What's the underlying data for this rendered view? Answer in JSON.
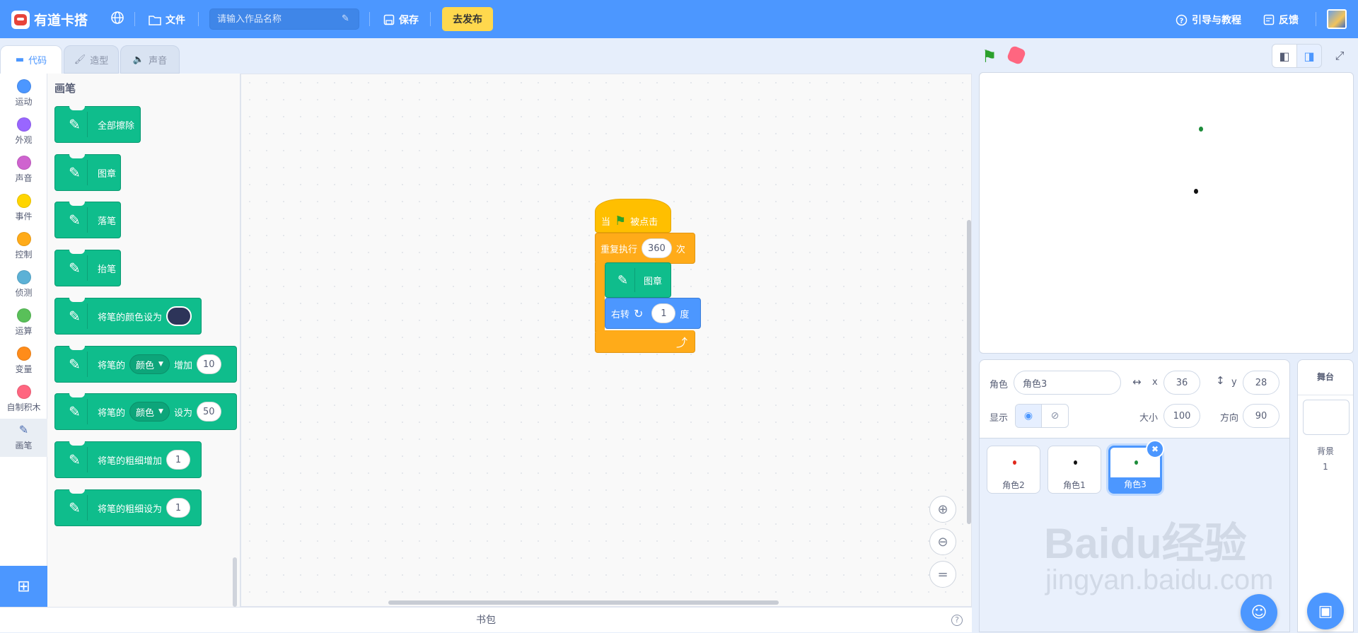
{
  "app": {
    "name": "有道卡搭",
    "file_label": "文件",
    "title_placeholder": "请输入作品名称",
    "save_label": "保存",
    "publish_label": "去发布",
    "guide_label": "引导与教程",
    "feedback_label": "反馈"
  },
  "tabs": {
    "code": "代码",
    "costume": "造型",
    "sound": "声音"
  },
  "categories": [
    {
      "label": "运动",
      "color": "#4c97ff"
    },
    {
      "label": "外观",
      "color": "#9966ff"
    },
    {
      "label": "声音",
      "color": "#cf63cf"
    },
    {
      "label": "事件",
      "color": "#ffd500"
    },
    {
      "label": "控制",
      "color": "#ffab19"
    },
    {
      "label": "侦测",
      "color": "#5cb1d6"
    },
    {
      "label": "运算",
      "color": "#59c059"
    },
    {
      "label": "变量",
      "color": "#ff8c1a"
    },
    {
      "label": "自制积木",
      "color": "#ff6680"
    },
    {
      "label": "画笔",
      "color": "pen"
    }
  ],
  "palette": {
    "title": "画笔",
    "blocks": {
      "clear": "全部擦除",
      "stamp": "图章",
      "pen_down": "落笔",
      "pen_up": "抬笔",
      "set_color_to": "将笔的颜色设为",
      "change_prefix": "将笔的",
      "color_option": "颜色",
      "change_by": "增加",
      "change_value": "10",
      "set_prefix": "将笔的",
      "set_to": "设为",
      "set_value": "50",
      "change_size": "将笔的粗细增加",
      "change_size_value": "1",
      "set_size": "将笔的粗细设为",
      "set_size_value": "1"
    }
  },
  "script": {
    "when_prefix": "当",
    "when_suffix": "被点击",
    "repeat_label": "重复执行",
    "repeat_count": "360",
    "repeat_unit": "次",
    "stamp_label": "图章",
    "turn_label": "右转",
    "turn_value": "1",
    "turn_unit": "度"
  },
  "backpack": {
    "label": "书包"
  },
  "sprite_info": {
    "sprite_label": "角色",
    "sprite_name": "角色3",
    "x_label": "x",
    "x_value": "36",
    "y_label": "y",
    "y_value": "28",
    "show_label": "显示",
    "size_label": "大小",
    "size_value": "100",
    "direction_label": "方向",
    "direction_value": "90"
  },
  "sprites": [
    {
      "name": "角色2",
      "color": "#e0281b"
    },
    {
      "name": "角色1",
      "color": "#111111"
    },
    {
      "name": "角色3",
      "color": "#1d8c3a"
    }
  ],
  "stage_panel": {
    "title": "舞台",
    "backdrop_label": "背景",
    "backdrop_count": "1"
  },
  "watermark": {
    "big": "Baidu经验",
    "small": "jingyan.baidu.com"
  },
  "colors": {
    "accent": "#4c97ff",
    "pen": "#0fbd8c",
    "control": "#ffab19",
    "events": "#ffbf00",
    "publish": "#ffd84d"
  }
}
